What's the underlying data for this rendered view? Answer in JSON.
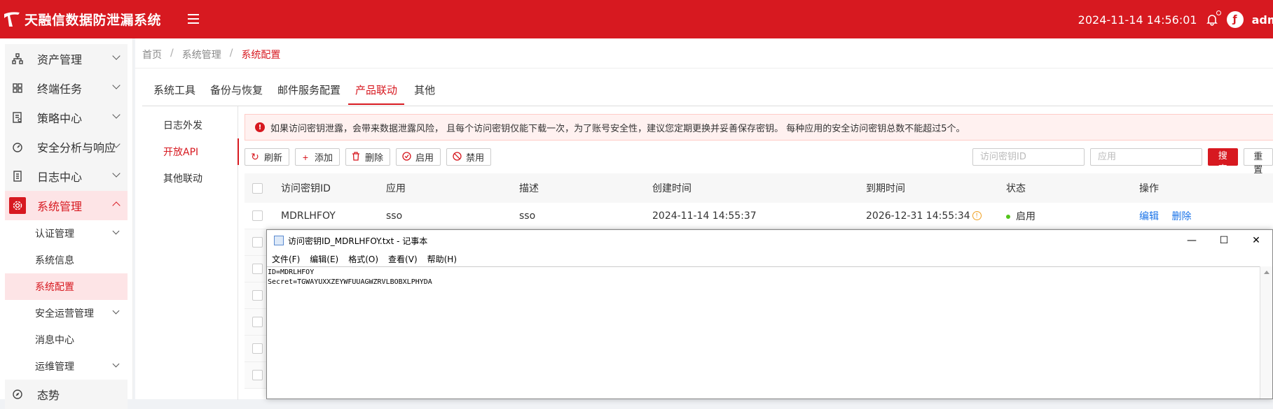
{
  "app": {
    "title": "天融信数据防泄漏系统",
    "datetime": "2024-11-14 14:56:01",
    "username": "admi"
  },
  "sidebar": {
    "items": [
      {
        "label": "资产管理",
        "icon": "assets-icon"
      },
      {
        "label": "终端任务",
        "icon": "terminal-task-icon"
      },
      {
        "label": "策略中心",
        "icon": "policy-icon"
      },
      {
        "label": "安全分析与响应",
        "icon": "security-analysis-icon"
      },
      {
        "label": "日志中心",
        "icon": "log-icon"
      },
      {
        "label": "系统管理",
        "icon": "gear-icon",
        "active": true
      }
    ],
    "subitems": [
      {
        "label": "认证管理",
        "has_children": true
      },
      {
        "label": "系统信息",
        "has_children": false
      },
      {
        "label": "系统配置",
        "has_children": false,
        "active": true
      },
      {
        "label": "安全运营管理",
        "has_children": true
      },
      {
        "label": "消息中心",
        "has_children": false
      },
      {
        "label": "运维管理",
        "has_children": true
      }
    ],
    "bottom_item": {
      "label": "态势",
      "icon": "compass-icon"
    }
  },
  "breadcrumb": {
    "home": "首页",
    "parent": "系统管理",
    "current": "系统配置"
  },
  "tabs": [
    "系统工具",
    "备份与恢复",
    "邮件服务配置",
    "产品联动",
    "其他"
  ],
  "active_tab": "产品联动",
  "subnav": [
    "日志外发",
    "开放API",
    "其他联动"
  ],
  "active_subnav": "开放API",
  "alert": {
    "text": "如果访问密钥泄露，会带来数据泄露风险， 且每个访问密钥仅能下载一次，为了账号安全性，建议您定期更换并妥善保存密钥。 每种应用的安全访问密钥总数不能超过5个。"
  },
  "toolbar": {
    "refresh": "刷新",
    "add": "添加",
    "delete": "删除",
    "enable": "启用",
    "disable": "禁用"
  },
  "search": {
    "key_placeholder": "访问密钥ID",
    "app_placeholder": "应用",
    "search_label": "搜索",
    "reset_label": "重置"
  },
  "table": {
    "headers": [
      "访问密钥ID",
      "应用",
      "描述",
      "创建时间",
      "到期时间",
      "状态",
      "操作"
    ],
    "rows": [
      {
        "key_id": "MDRLHFOY",
        "app": "sso",
        "description": "sso",
        "created": "2024-11-14 14:55:37",
        "expires": "2026-12-31 14:55:34",
        "status": "启用",
        "actions": [
          "编辑",
          "删除"
        ]
      }
    ]
  },
  "notepad": {
    "title": "访问密钥ID_MDRLHFOY.txt - 记事本",
    "menu": [
      "文件(F)",
      "编辑(E)",
      "格式(O)",
      "查看(V)",
      "帮助(H)"
    ],
    "line1": "ID=MDRLHFOY",
    "line2": "Secret=TGWAYUXXZEYWFUUAGWZRVLBOBXLPHYDA"
  },
  "colors": {
    "brand_red": "#d71920",
    "status_green": "#52c41a",
    "link_blue": "#1a73e8"
  }
}
